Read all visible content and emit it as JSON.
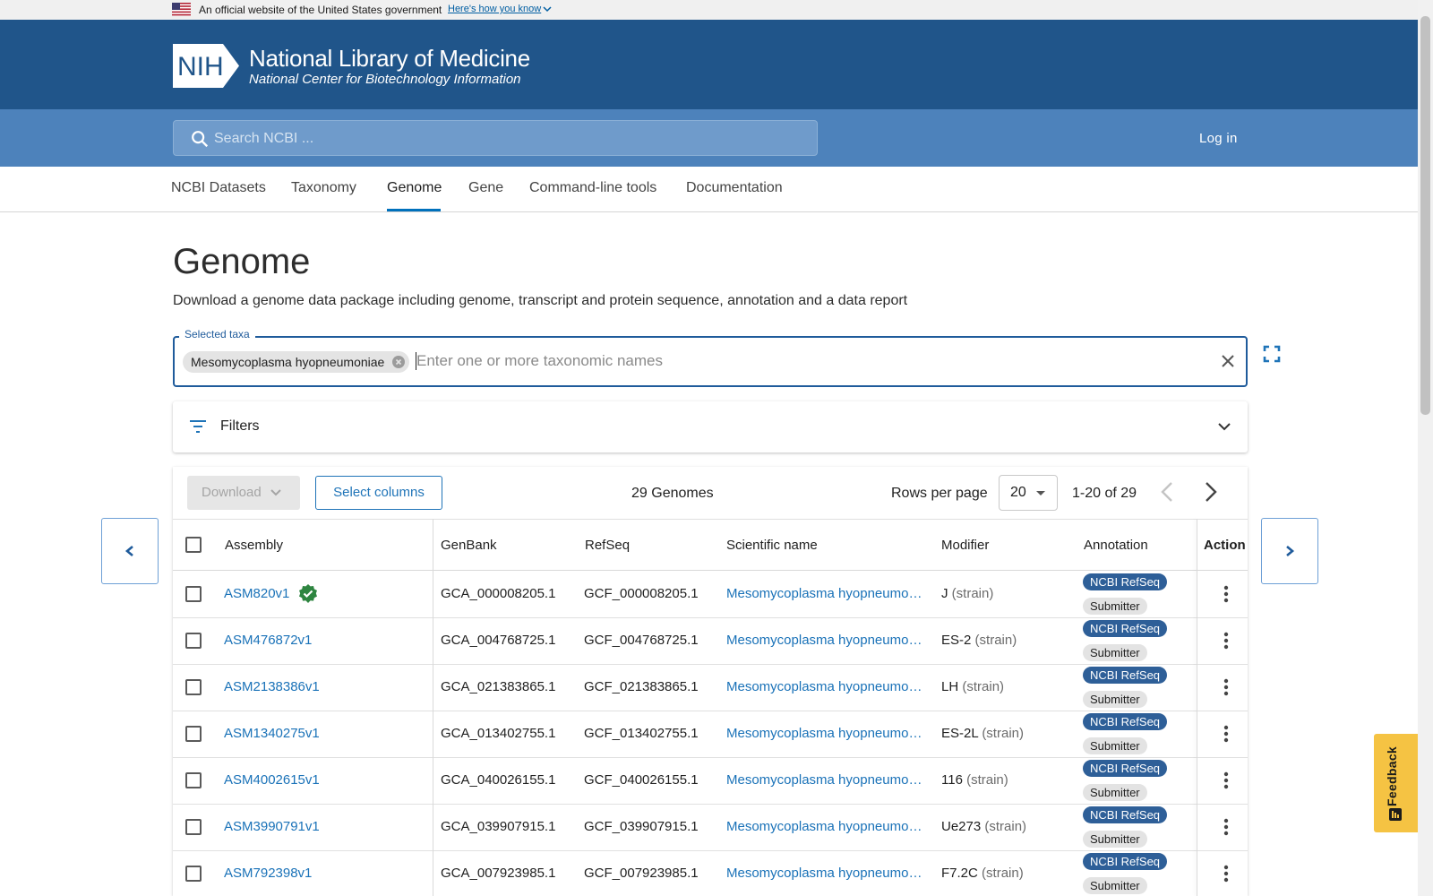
{
  "gov_banner": {
    "official_text": "An official website of the United States government",
    "how_text": "Here's how you know"
  },
  "header": {
    "logo_text": "NIH",
    "title": "National Library of Medicine",
    "subtitle": "National Center for Biotechnology Information",
    "search_placeholder": "Search NCBI ...",
    "login_label": "Log in"
  },
  "tabs": [
    {
      "label": "NCBI Datasets"
    },
    {
      "label": "Taxonomy"
    },
    {
      "label": "Genome",
      "active": true
    },
    {
      "label": "Gene"
    },
    {
      "label": "Command-line tools"
    },
    {
      "label": "Documentation"
    }
  ],
  "page": {
    "title": "Genome",
    "description": "Download a genome data package including genome, transcript and protein sequence, annotation and a data report"
  },
  "taxa": {
    "legend": "Selected taxa",
    "chip": "Mesomycoplasma hyopneumoniae",
    "placeholder": "Enter one or more taxonomic names"
  },
  "filters": {
    "label": "Filters"
  },
  "toolbar": {
    "download_label": "Download",
    "select_columns_label": "Select columns",
    "genome_count": "29 Genomes",
    "rows_per_page_label": "Rows per page",
    "rows_per_page_value": "20",
    "range": "1-20 of 29"
  },
  "table": {
    "columns": [
      "Assembly",
      "GenBank",
      "RefSeq",
      "Scientific name",
      "Modifier",
      "Annotation",
      "Action"
    ],
    "rows": [
      {
        "assembly": "ASM820v1",
        "verified": true,
        "genbank": "GCA_000008205.1",
        "refseq": "GCF_000008205.1",
        "scientific_name": "Mesomycoplasma hyopneumoniae",
        "modifier": "J",
        "modifier_type": "(strain)",
        "annotation": [
          "NCBI RefSeq",
          "Submitter"
        ]
      },
      {
        "assembly": "ASM476872v1",
        "verified": false,
        "genbank": "GCA_004768725.1",
        "refseq": "GCF_004768725.1",
        "scientific_name": "Mesomycoplasma hyopneumoniae",
        "modifier": "ES-2",
        "modifier_type": "(strain)",
        "annotation": [
          "NCBI RefSeq",
          "Submitter"
        ]
      },
      {
        "assembly": "ASM2138386v1",
        "verified": false,
        "genbank": "GCA_021383865.1",
        "refseq": "GCF_021383865.1",
        "scientific_name": "Mesomycoplasma hyopneumoniae",
        "modifier": "LH",
        "modifier_type": "(strain)",
        "annotation": [
          "NCBI RefSeq",
          "Submitter"
        ]
      },
      {
        "assembly": "ASM1340275v1",
        "verified": false,
        "genbank": "GCA_013402755.1",
        "refseq": "GCF_013402755.1",
        "scientific_name": "Mesomycoplasma hyopneumoniae",
        "modifier": "ES-2L",
        "modifier_type": "(strain)",
        "annotation": [
          "NCBI RefSeq",
          "Submitter"
        ]
      },
      {
        "assembly": "ASM4002615v1",
        "verified": false,
        "genbank": "GCA_040026155.1",
        "refseq": "GCF_040026155.1",
        "scientific_name": "Mesomycoplasma hyopneumoniae",
        "modifier": "116",
        "modifier_type": "(strain)",
        "annotation": [
          "NCBI RefSeq",
          "Submitter"
        ]
      },
      {
        "assembly": "ASM3990791v1",
        "verified": false,
        "genbank": "GCA_039907915.1",
        "refseq": "GCF_039907915.1",
        "scientific_name": "Mesomycoplasma hyopneumoniae",
        "modifier": "Ue273",
        "modifier_type": "(strain)",
        "annotation": [
          "NCBI RefSeq",
          "Submitter"
        ]
      },
      {
        "assembly": "ASM792398v1",
        "verified": false,
        "genbank": "GCA_007923985.1",
        "refseq": "GCF_007923985.1",
        "scientific_name": "Mesomycoplasma hyopneumoniae",
        "modifier": "F7.2C",
        "modifier_type": "(strain)",
        "annotation": [
          "NCBI RefSeq",
          "Submitter"
        ]
      }
    ]
  },
  "feedback": {
    "label": "Feedback"
  },
  "colors": {
    "header_blue": "#20558a",
    "search_blue": "#4d82bb",
    "link_blue": "#1a72b8",
    "badge_refseq": "#2e5f98",
    "feedback_yellow": "#f5c343",
    "verified_green": "#2e8540"
  }
}
